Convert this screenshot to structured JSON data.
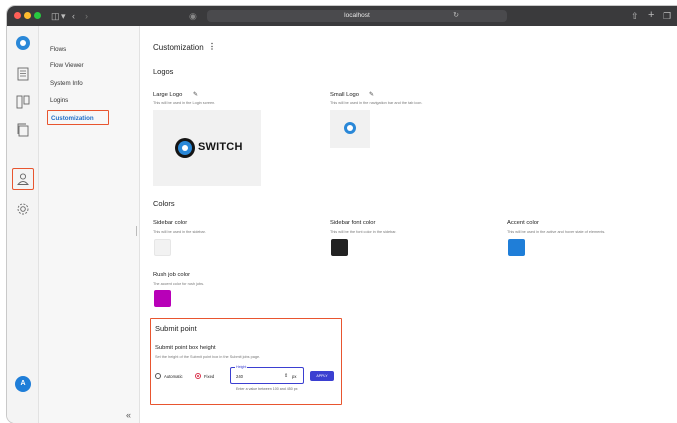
{
  "browser": {
    "url": "localhost"
  },
  "rail": {
    "avatar_initial": "A"
  },
  "sidebar": {
    "items": [
      {
        "label": "Flows"
      },
      {
        "label": "Flow Viewer"
      },
      {
        "label": "System Info"
      },
      {
        "label": "Logins"
      },
      {
        "label": "Customization"
      }
    ],
    "active_index": 4
  },
  "page": {
    "title": "Customization"
  },
  "logos": {
    "section_title": "Logos",
    "large": {
      "label": "Large Logo",
      "description": "This will be used in the Login screen.",
      "wordmark": "SWITCH"
    },
    "small": {
      "label": "Small Logo",
      "description": "This will be used in the navigation bar and the tab icon."
    }
  },
  "colors": {
    "section_title": "Colors",
    "items": [
      {
        "label": "Sidebar color",
        "description": "This will be used in the sidebar.",
        "value": "#f2f2f2"
      },
      {
        "label": "Sidebar font color",
        "description": "This will be the font color in the sidebar.",
        "value": "#222222"
      },
      {
        "label": "Accent color",
        "description": "This will be used in the active and hover state of elements.",
        "value": "#1f7ed8"
      },
      {
        "label": "Rush job color",
        "description": "The accent color for rush jobs.",
        "value": "#b800b8"
      }
    ]
  },
  "submit_point": {
    "section_title": "Submit point",
    "field_label": "Submit point box height",
    "description": "Set the height of the Submit point box in the Submit jobs page.",
    "options": [
      {
        "label": "Automatic",
        "checked": false
      },
      {
        "label": "Fixed",
        "checked": true
      }
    ],
    "height": {
      "legend": "Height",
      "value": "240",
      "unit": "px",
      "help": "Enter a value between 100 and 450 px"
    },
    "apply_label": "APPLY"
  }
}
